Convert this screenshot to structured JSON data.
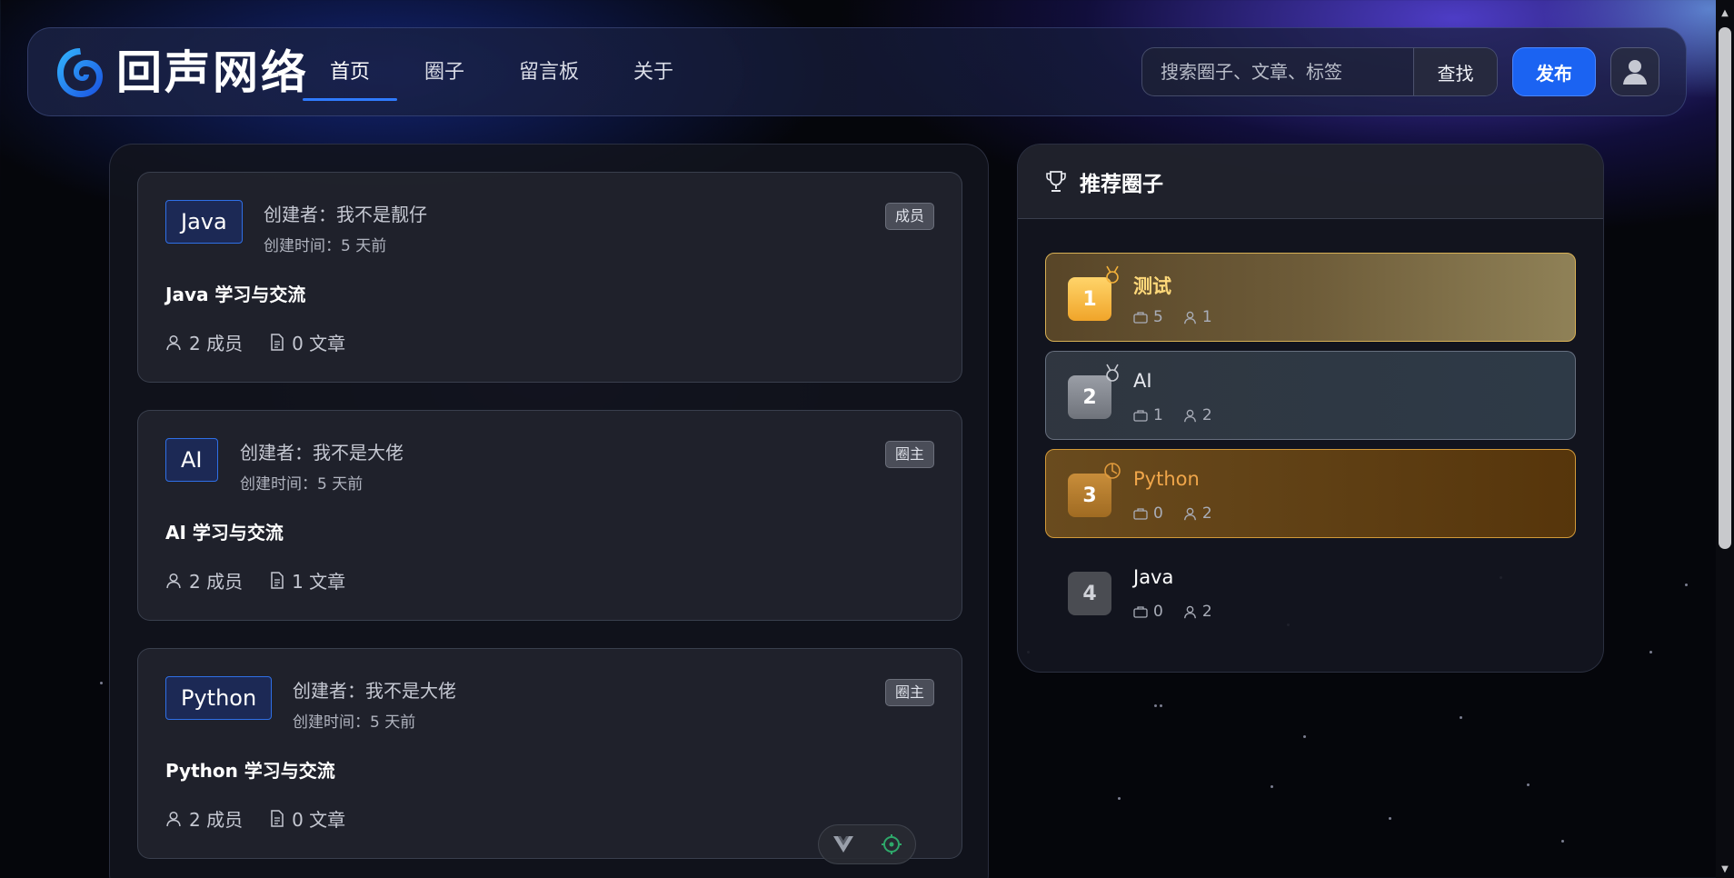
{
  "header": {
    "logo_text": "回声网络",
    "nav": [
      {
        "label": "首页",
        "active": true
      },
      {
        "label": "圈子",
        "active": false
      },
      {
        "label": "留言板",
        "active": false
      },
      {
        "label": "关于",
        "active": false
      }
    ],
    "search_placeholder": "搜索圈子、文章、标签",
    "search_button": "查找",
    "publish_button": "发布",
    "accent_color": "#1b63f2"
  },
  "circles": [
    {
      "tag": "Java",
      "creator": "创建者：我不是靓仔",
      "created": "创建时间：5 天前",
      "badge": "成员",
      "title": "Java 学习与交流",
      "members": "2 成员",
      "articles": "0 文章"
    },
    {
      "tag": "AI",
      "creator": "创建者：我不是大佬",
      "created": "创建时间：5 天前",
      "badge": "圈主",
      "title": "AI 学习与交流",
      "members": "2 成员",
      "articles": "1 文章"
    },
    {
      "tag": "Python",
      "creator": "创建者：我不是大佬",
      "created": "创建时间：5 天前",
      "badge": "圈主",
      "title": "Python 学习与交流",
      "members": "2 成员",
      "articles": "0 文章"
    }
  ],
  "recommended": {
    "title": "推荐圈子",
    "items": [
      {
        "rank": "1",
        "name": "测试",
        "posts": "5",
        "members": "1"
      },
      {
        "rank": "2",
        "name": "AI",
        "posts": "1",
        "members": "2"
      },
      {
        "rank": "3",
        "name": "Python",
        "posts": "0",
        "members": "2"
      },
      {
        "rank": "4",
        "name": "Java",
        "posts": "0",
        "members": "2"
      }
    ]
  }
}
